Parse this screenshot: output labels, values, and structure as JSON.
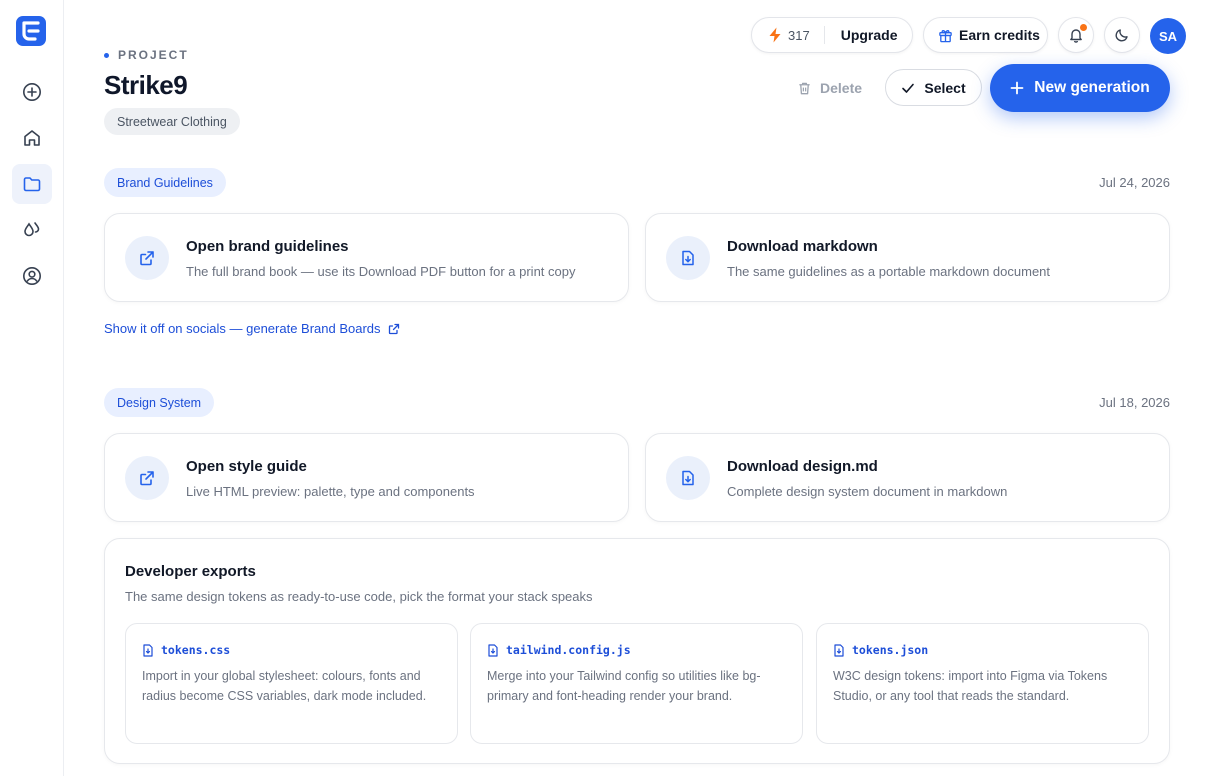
{
  "topbar": {
    "credits_count": "317",
    "upgrade_label": "Upgrade",
    "earn_credits_label": "Earn credits",
    "avatar_initials": "SA",
    "notification_dot_color": "#f97316"
  },
  "sidebar": {
    "items": [
      {
        "name": "new",
        "icon": "plus-circle-icon"
      },
      {
        "name": "home",
        "icon": "home-icon"
      },
      {
        "name": "projects",
        "icon": "folder-icon",
        "active": true
      },
      {
        "name": "palette",
        "icon": "droplets-icon"
      },
      {
        "name": "account",
        "icon": "user-circle-icon"
      }
    ]
  },
  "header": {
    "eyebrow": "PROJECT",
    "title": "Strike9",
    "industry_tag": "Streetwear Clothing",
    "delete_label": "Delete",
    "select_label": "Select",
    "new_generation_label": "New generation"
  },
  "brand_section": {
    "tag": "Brand Guidelines",
    "date": "Jul 24, 2026",
    "cards": [
      {
        "title": "Open brand guidelines",
        "desc": "The full brand book — use its Download PDF button for a print copy",
        "icon": "external-link-icon"
      },
      {
        "title": "Download markdown",
        "desc": "The same guidelines as a portable markdown document",
        "icon": "file-download-icon"
      }
    ],
    "social_link": "Show it off on socials — generate Brand Boards"
  },
  "design_section": {
    "tag": "Design System",
    "date": "Jul 18, 2026",
    "cards": [
      {
        "title": "Open style guide",
        "desc": "Live HTML preview: palette, type and components",
        "icon": "external-link-icon"
      },
      {
        "title": "Download design.md",
        "desc": "Complete design system document in markdown",
        "icon": "file-download-icon"
      }
    ]
  },
  "dev_exports": {
    "title": "Developer exports",
    "subtitle": "The same design tokens as ready-to-use code, pick the format your stack speaks",
    "files": [
      {
        "name": "tokens.css",
        "desc": "Import in your global stylesheet: colours, fonts and radius become CSS variables, dark mode included."
      },
      {
        "name": "tailwind.config.js",
        "desc": "Merge into your Tailwind config so utilities like bg-primary and font-heading render your brand."
      },
      {
        "name": "tokens.json",
        "desc": "W3C design tokens: import into Figma via Tokens Studio, or any tool that reads the standard."
      }
    ]
  },
  "colors": {
    "accent": "#2563eb",
    "tag_bg": "#e8efff",
    "tag_text": "#1d4ed8"
  }
}
